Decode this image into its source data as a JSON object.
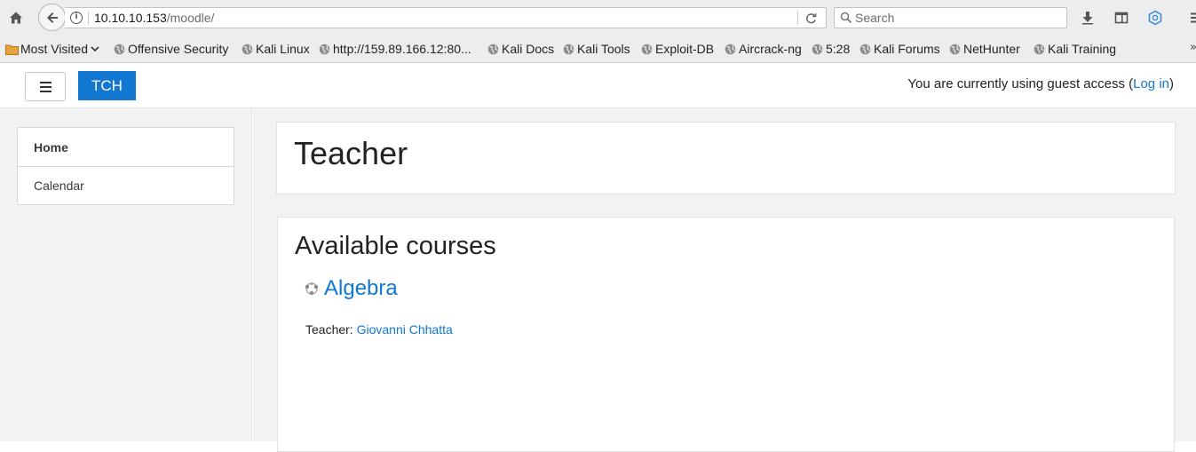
{
  "browser": {
    "url_host": "10.10.10.153",
    "url_path": "/moodle/",
    "search_placeholder": "Search",
    "bookmarks": [
      {
        "label": "Most Visited",
        "type": "folder"
      },
      {
        "label": "Offensive Security",
        "type": "link"
      },
      {
        "label": "Kali Linux",
        "type": "link"
      },
      {
        "label": "http://159.89.166.12:80...",
        "type": "link"
      },
      {
        "label": "Kali Docs",
        "type": "link"
      },
      {
        "label": "Kali Tools",
        "type": "link"
      },
      {
        "label": "Exploit-DB",
        "type": "link"
      },
      {
        "label": "Aircrack-ng",
        "type": "link"
      },
      {
        "label": "5:28",
        "type": "link"
      },
      {
        "label": "Kali Forums",
        "type": "link"
      },
      {
        "label": "NetHunter",
        "type": "link"
      },
      {
        "label": "Kali Training",
        "type": "link"
      }
    ],
    "overflow_label": "»"
  },
  "navbar": {
    "site_name": "TCH",
    "login_prefix": "You are currently using guest access (",
    "login_link": "Log in",
    "login_suffix": ")"
  },
  "drawer": {
    "items": [
      {
        "label": "Home",
        "active": true
      },
      {
        "label": "Calendar",
        "active": false
      }
    ]
  },
  "main": {
    "page_title": "Teacher",
    "courses_heading": "Available courses",
    "course": {
      "name": "Algebra",
      "teacher_label": "Teacher: ",
      "teacher_name": "Giovanni Chhatta"
    }
  },
  "colors": {
    "brand": "#1177d1",
    "link": "#1177d1",
    "page_bg": "#f2f2f2"
  }
}
